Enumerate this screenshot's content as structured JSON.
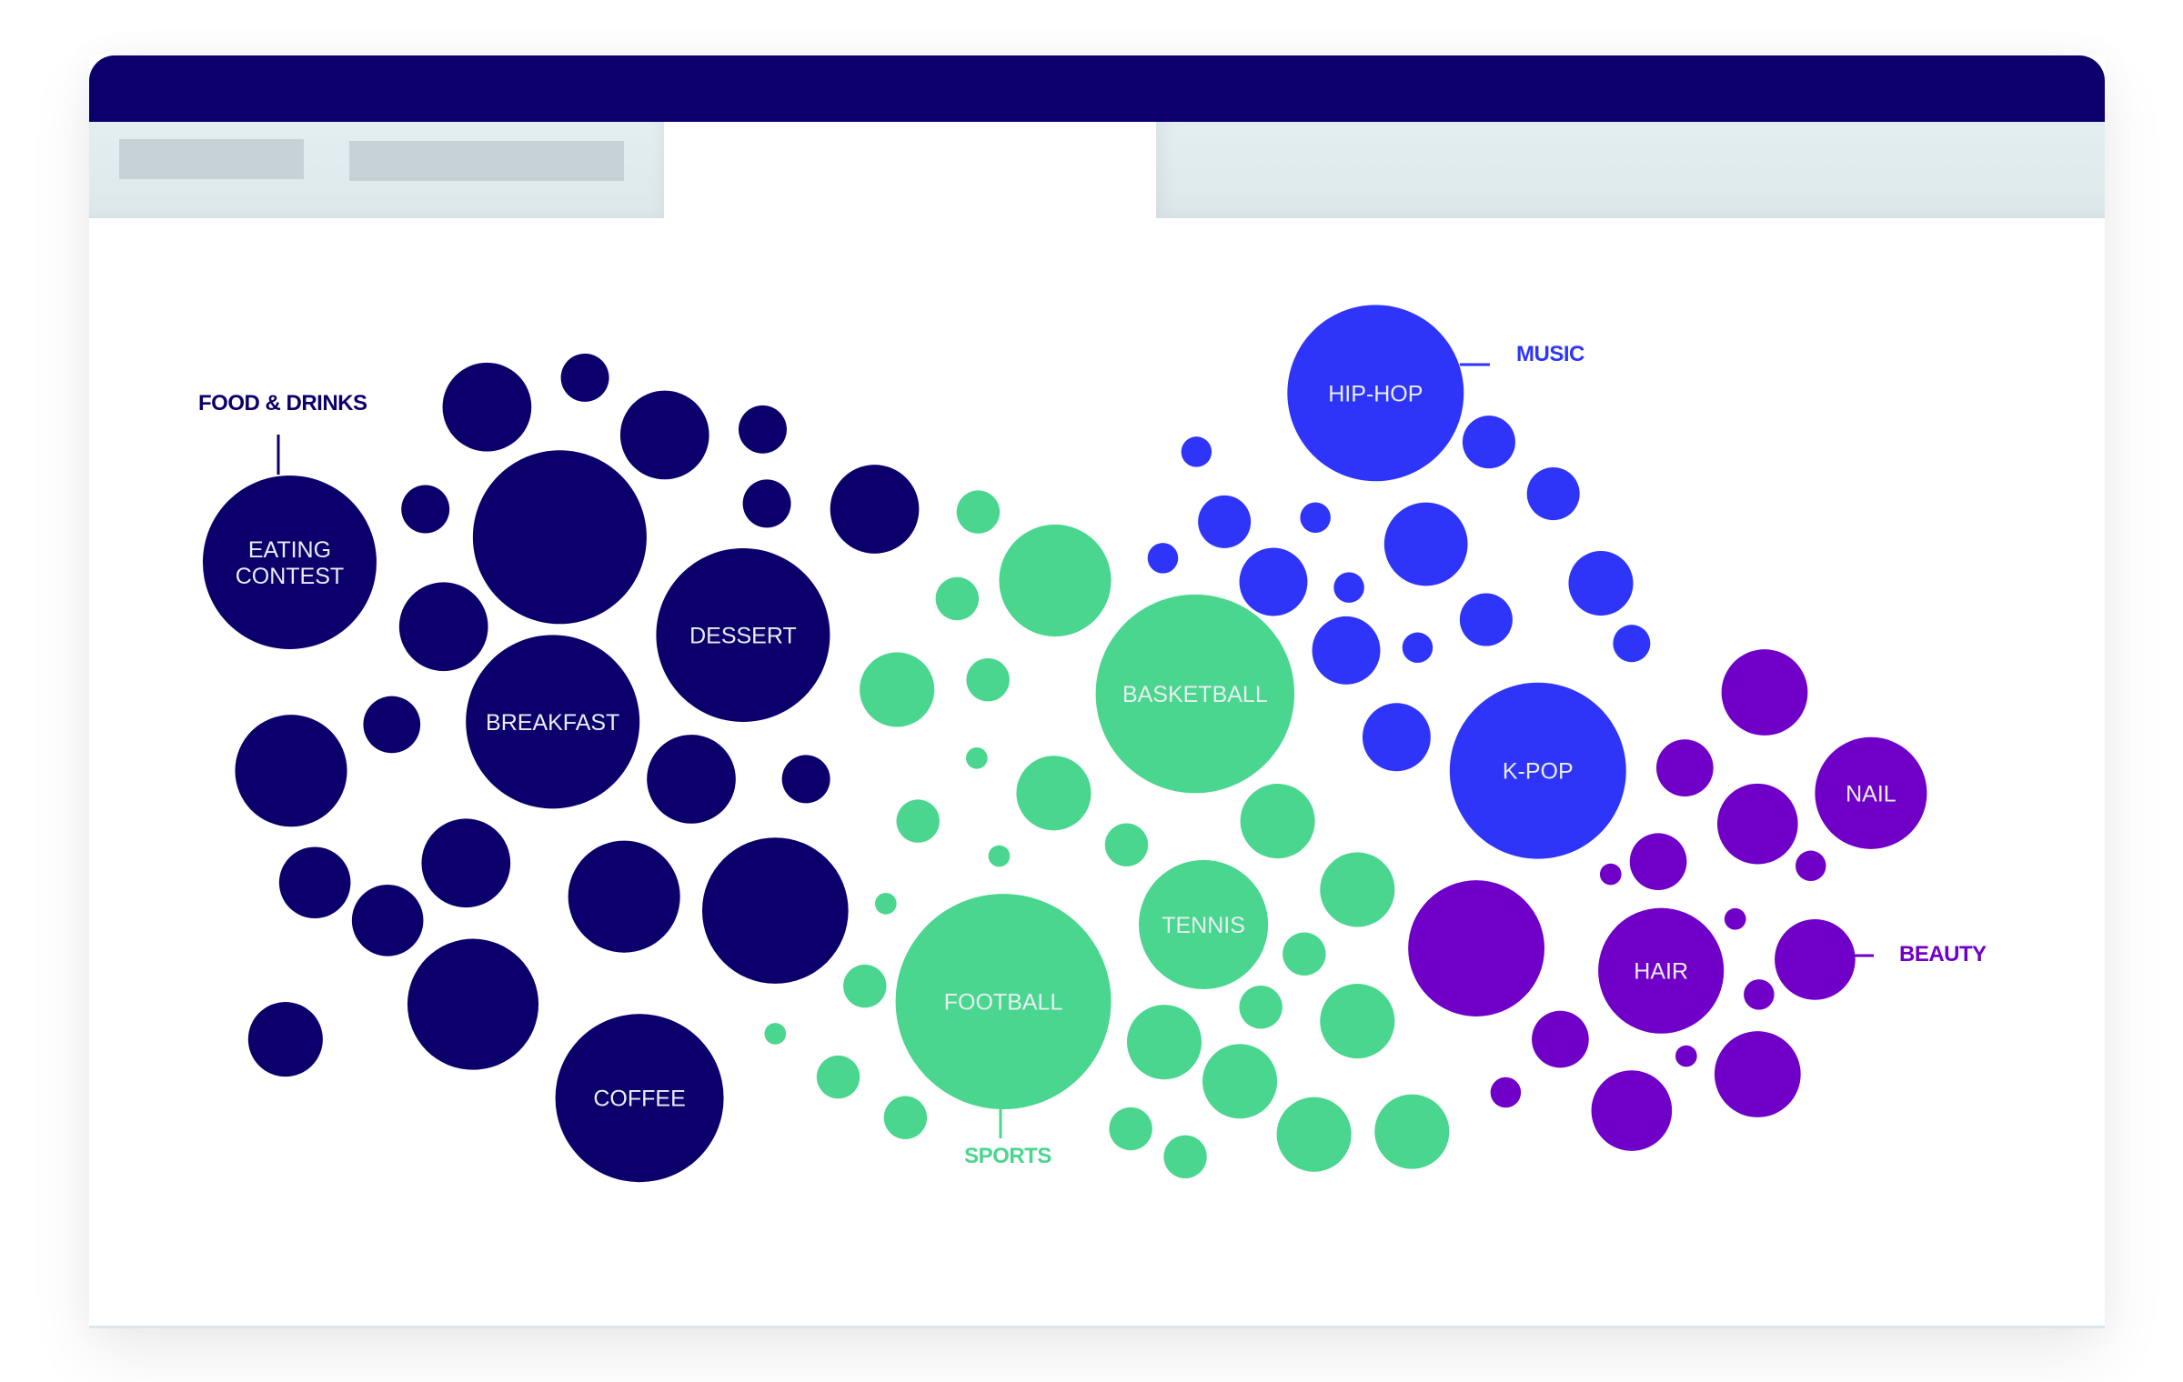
{
  "window": {
    "toolbar_placeholders": [
      "",
      ""
    ]
  },
  "colors": {
    "titlebar": "#0b006b",
    "food": "#0b006b",
    "sports": "#4ad68e",
    "music": "#2f35f8",
    "beauty": "#7000c8",
    "bubble_text": "#e8eef2"
  },
  "chart_data": {
    "type": "packed-bubble",
    "title": "",
    "value_scale": "relative area (largest bubble = 100)",
    "groups": [
      {
        "name": "FOOD & DRINKS",
        "key": "food",
        "bubbles": [
          {
            "label": "EATING CONTEST",
            "value": 65
          },
          {
            "label": "",
            "value": 17
          },
          {
            "label": "",
            "value": 5
          },
          {
            "label": "",
            "value": 17
          },
          {
            "label": "",
            "value": 5
          },
          {
            "label": "",
            "value": 5
          },
          {
            "label": "",
            "value": 65
          },
          {
            "label": "",
            "value": 5
          },
          {
            "label": "",
            "value": 17
          },
          {
            "label": "",
            "value": 17
          },
          {
            "label": "DESSERT",
            "value": 65
          },
          {
            "label": "BREAKFAST",
            "value": 65
          },
          {
            "label": "",
            "value": 7
          },
          {
            "label": "",
            "value": 27
          },
          {
            "label": "",
            "value": 17
          },
          {
            "label": "",
            "value": 5
          },
          {
            "label": "",
            "value": 11
          },
          {
            "label": "",
            "value": 17
          },
          {
            "label": "",
            "value": 11
          },
          {
            "label": "",
            "value": 27
          },
          {
            "label": "",
            "value": 46
          },
          {
            "label": "",
            "value": 37
          },
          {
            "label": "",
            "value": 12
          },
          {
            "label": "COFFEE",
            "value": 61
          }
        ]
      },
      {
        "name": "SPORTS",
        "key": "sports",
        "bubbles": [
          {
            "label": "",
            "value": 4
          },
          {
            "label": "",
            "value": 27
          },
          {
            "label": "",
            "value": 4
          },
          {
            "label": "",
            "value": 12
          },
          {
            "label": "",
            "value": 4
          },
          {
            "label": "BASKETBALL",
            "value": 85
          },
          {
            "label": "",
            "value": 1
          },
          {
            "label": "",
            "value": 12
          },
          {
            "label": "",
            "value": 4
          },
          {
            "label": "",
            "value": 1
          },
          {
            "label": "",
            "value": 4
          },
          {
            "label": "",
            "value": 12
          },
          {
            "label": "",
            "value": 1
          },
          {
            "label": "",
            "value": 12
          },
          {
            "label": "TENNIS",
            "value": 36
          },
          {
            "label": "",
            "value": 4
          },
          {
            "label": "FOOTBALL",
            "value": 100
          },
          {
            "label": "",
            "value": 4
          },
          {
            "label": "",
            "value": 4
          },
          {
            "label": "",
            "value": 12
          },
          {
            "label": "",
            "value": 1
          },
          {
            "label": "",
            "value": 12
          },
          {
            "label": "",
            "value": 12
          },
          {
            "label": "",
            "value": 4
          },
          {
            "label": "",
            "value": 4
          },
          {
            "label": "",
            "value": 4
          },
          {
            "label": "",
            "value": 4
          },
          {
            "label": "",
            "value": 12
          },
          {
            "label": "",
            "value": 12
          }
        ]
      },
      {
        "name": "MUSIC",
        "key": "music",
        "bubbles": [
          {
            "label": "HIP-HOP",
            "value": 67
          },
          {
            "label": "",
            "value": 2
          },
          {
            "label": "",
            "value": 6
          },
          {
            "label": "",
            "value": 6
          },
          {
            "label": "",
            "value": 2
          },
          {
            "label": "",
            "value": 6
          },
          {
            "label": "",
            "value": 2
          },
          {
            "label": "",
            "value": 10
          },
          {
            "label": "",
            "value": 2
          },
          {
            "label": "",
            "value": 15
          },
          {
            "label": "",
            "value": 9
          },
          {
            "label": "",
            "value": 10
          },
          {
            "label": "",
            "value": 2
          },
          {
            "label": "",
            "value": 6
          },
          {
            "label": "",
            "value": 3
          },
          {
            "label": "",
            "value": 10
          },
          {
            "label": "K-POP",
            "value": 67
          }
        ]
      },
      {
        "name": "BEAUTY",
        "key": "beauty",
        "bubbles": [
          {
            "label": "",
            "value": 16
          },
          {
            "label": "",
            "value": 7
          },
          {
            "label": "NAIL",
            "value": 27
          },
          {
            "label": "",
            "value": 14
          },
          {
            "label": "",
            "value": 7
          },
          {
            "label": "",
            "value": 1
          },
          {
            "label": "",
            "value": 2
          },
          {
            "label": "",
            "value": 40
          },
          {
            "label": "",
            "value": 1
          },
          {
            "label": "HAIR",
            "value": 34
          },
          {
            "label": "",
            "value": 14
          },
          {
            "label": "",
            "value": 2
          },
          {
            "label": "",
            "value": 7
          },
          {
            "label": "",
            "value": 1
          },
          {
            "label": "",
            "value": 16
          },
          {
            "label": "",
            "value": 2
          },
          {
            "label": "",
            "value": 14
          }
        ]
      }
    ]
  }
}
